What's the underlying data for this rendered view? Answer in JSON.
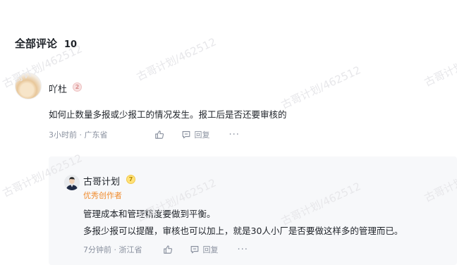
{
  "watermark": "古哥计划/462512",
  "comments_header": {
    "title": "全部评论",
    "count": "10"
  },
  "comment": {
    "author": "吖杜",
    "level": "2",
    "text": "如何止数量多报或少报工的情况发生。报工后是否还要审核的",
    "time_location": "3小时前 · 广东省",
    "reply_label": "回复",
    "more_label": "···"
  },
  "reply": {
    "author": "古哥计划",
    "level": "7",
    "tag": "优秀创作者",
    "lines": [
      "管理成本和管理精度要做到平衡。",
      "多报少报可以提醒，审核也可以加上，就是30人小厂是否要做这样多的管理而已。"
    ],
    "time_location": "7分钟前 · 浙江省",
    "reply_label": "回复",
    "more_label": "···"
  },
  "colors": {
    "text": "#1f2329",
    "muted": "#8a919f",
    "tag": "#f08c2e",
    "reply_bg": "#f7f8fa",
    "watermark": "#e7e7ea"
  },
  "icons": {
    "like": "thumbs-up-icon",
    "reply": "comment-icon",
    "more": "ellipsis-icon"
  }
}
